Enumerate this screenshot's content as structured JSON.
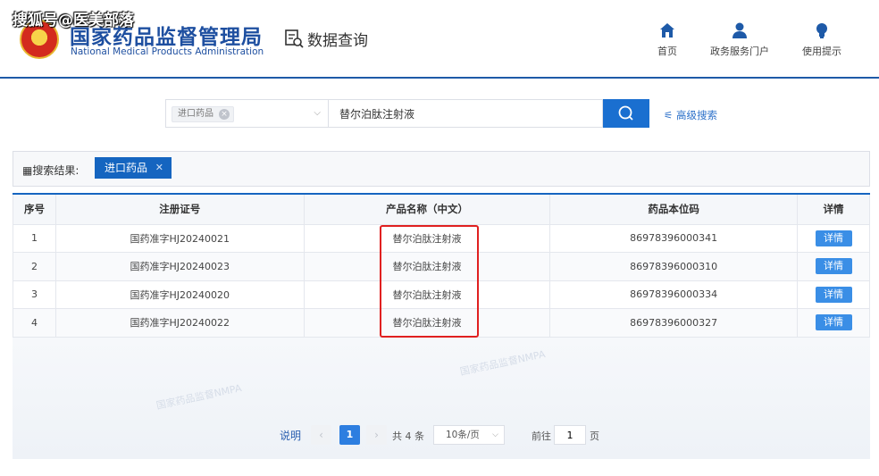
{
  "watermark": "搜狐号@医美部落",
  "header": {
    "org_cn": "国家药品监督管理局",
    "org_en": "National Medical Products Administration",
    "section_title": "数据查询",
    "nav": [
      {
        "label": "首页",
        "icon": "home-icon"
      },
      {
        "label": "政务服务门户",
        "icon": "user-icon"
      },
      {
        "label": "使用提示",
        "icon": "lightbulb-icon"
      }
    ]
  },
  "search": {
    "category_tag": "进口药品",
    "keyword": "替尔泊肽注射液",
    "advanced_label": "高级搜索"
  },
  "results": {
    "label": "搜索结果:",
    "active_tag": "进口药品"
  },
  "table": {
    "headers": [
      "序号",
      "注册证号",
      "产品名称（中文）",
      "药品本位码",
      "详情"
    ],
    "rows": [
      {
        "idx": "1",
        "reg": "国药准字HJ20240021",
        "name": "替尔泊肽注射液",
        "code": "86978396000341",
        "detail": "详情"
      },
      {
        "idx": "2",
        "reg": "国药准字HJ20240023",
        "name": "替尔泊肽注射液",
        "code": "86978396000310",
        "detail": "详情"
      },
      {
        "idx": "3",
        "reg": "国药准字HJ20240020",
        "name": "替尔泊肽注射液",
        "code": "86978396000334",
        "detail": "详情"
      },
      {
        "idx": "4",
        "reg": "国药准字HJ20240022",
        "name": "替尔泊肽注射液",
        "code": "86978396000327",
        "detail": "详情"
      }
    ]
  },
  "pagination": {
    "explain": "说明",
    "prev": "‹",
    "current": "1",
    "next": "›",
    "total": "共 4 条",
    "page_size": "10条/页",
    "goto_label": "前往",
    "goto_value": "1",
    "page_unit": "页"
  },
  "background_marks": [
    "国家药品监督NMPA",
    "国家药品监督NMPA"
  ],
  "colors": {
    "brand_blue": "#1565c0",
    "highlight_red": "#e02020"
  }
}
